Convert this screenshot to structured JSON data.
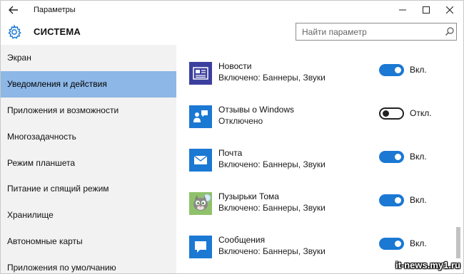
{
  "window": {
    "title": "Параметры"
  },
  "header": {
    "section_title": "СИСТЕМА",
    "search_placeholder": "Найти параметр"
  },
  "sidebar": {
    "items": [
      {
        "label": "Экран",
        "active": false
      },
      {
        "label": "Уведомления и действия",
        "active": true
      },
      {
        "label": "Приложения и возможности",
        "active": false
      },
      {
        "label": "Многозадачность",
        "active": false
      },
      {
        "label": "Режим планшета",
        "active": false
      },
      {
        "label": "Питание и спящий режим",
        "active": false
      },
      {
        "label": "Хранилище",
        "active": false
      },
      {
        "label": "Автономные карты",
        "active": false
      },
      {
        "label": "Приложения по умолчанию",
        "active": false
      }
    ]
  },
  "apps": [
    {
      "name": "Новости",
      "status": "Включено: Баннеры, Звуки",
      "toggle": "on",
      "toggle_label": "Вкл.",
      "icon": "news-icon",
      "icon_bg": "#3b3f9e"
    },
    {
      "name": "Отзывы о Windows",
      "status": "Отключено",
      "toggle": "off",
      "toggle_label": "Откл.",
      "icon": "feedback-icon",
      "icon_bg": "#1b78d3"
    },
    {
      "name": "Почта",
      "status": "Включено: Баннеры, Звуки",
      "toggle": "on",
      "toggle_label": "Вкл.",
      "icon": "mail-icon",
      "icon_bg": "#1b78d3"
    },
    {
      "name": "Пузырьки Тома",
      "status": "Включено: Баннеры, Звуки",
      "toggle": "on",
      "toggle_label": "Вкл.",
      "icon": "tom-bubbles-icon",
      "icon_bg": "#6aa84f"
    },
    {
      "name": "Сообщения",
      "status": "Включено: Баннеры, Звуки",
      "toggle": "on",
      "toggle_label": "Вкл.",
      "icon": "messages-icon",
      "icon_bg": "#1b78d3"
    }
  ],
  "colors": {
    "accent": "#1b78d3",
    "sidebar_bg": "#f2f2f2",
    "sidebar_active": "#8cb7e6"
  },
  "watermark": "it-news.my1.ru"
}
